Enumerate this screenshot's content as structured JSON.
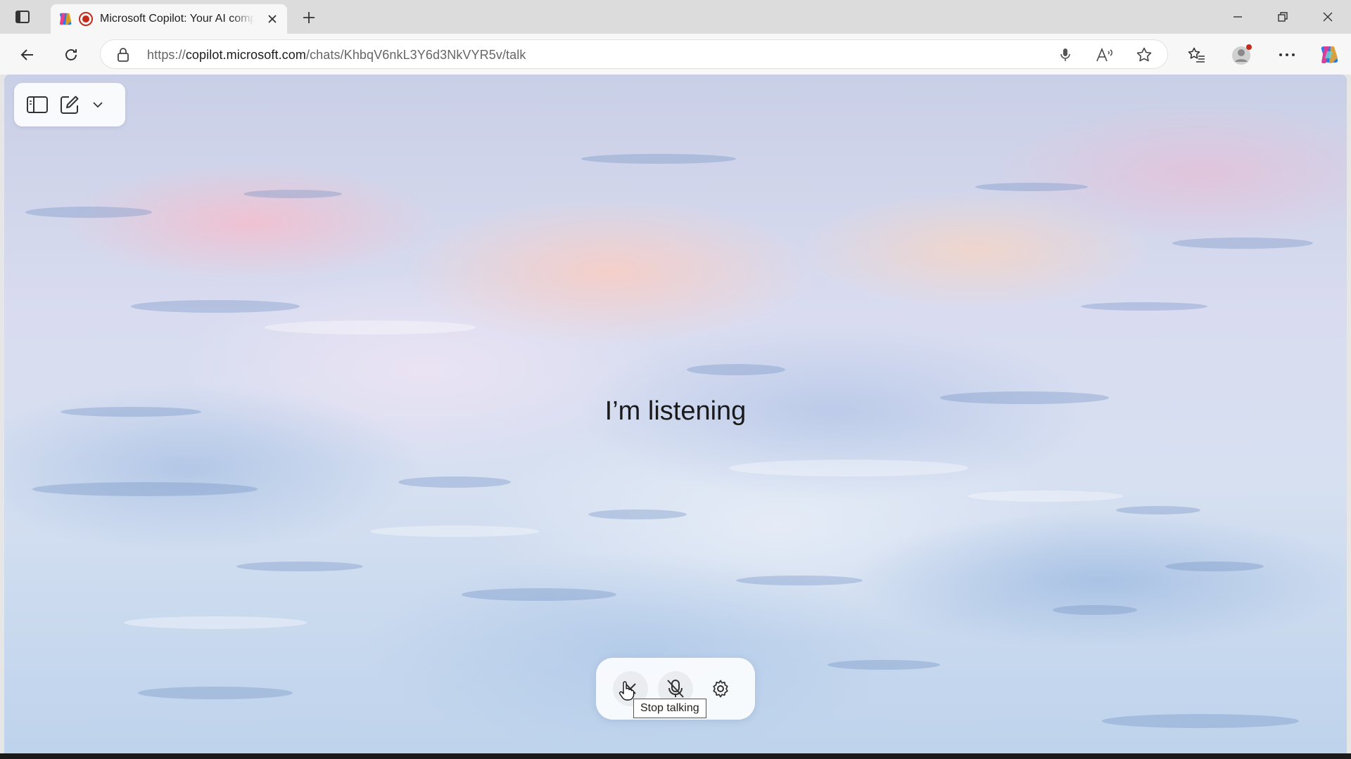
{
  "browser": {
    "tab": {
      "title": "Microsoft Copilot: Your AI companion",
      "close_label": "×"
    },
    "new_tab_label": "+",
    "address": {
      "url_prefix": "https://",
      "url_domain": "copilot.microsoft.com",
      "url_path": "/chats/KhbqV6nkL3Y6d3NkVYR5v/talk"
    }
  },
  "page": {
    "status_text": "I’m listening",
    "controls": {
      "tooltip": "Stop talking"
    }
  },
  "icons": {
    "tab_actions": "tab-actions-icon",
    "favicon": "copilot-icon",
    "recording": "recording-icon",
    "back": "back-arrow-icon",
    "refresh": "refresh-icon",
    "lock": "lock-icon",
    "mic": "microphone-icon",
    "read_aloud": "read-aloud-icon",
    "favorite": "star-icon",
    "favorites": "favorites-icon",
    "profile": "profile-icon",
    "more": "more-icon",
    "copilot_sidebar": "copilot-icon",
    "sidebar_toggle": "sidebar-icon",
    "new_chat": "compose-icon",
    "dropdown": "chevron-down-icon",
    "stop_talking": "close-icon",
    "mute": "microphone-off-icon",
    "settings": "gear-icon"
  },
  "colors": {
    "record_red": "#c42b1c",
    "text_dark": "#1a1a1a"
  }
}
